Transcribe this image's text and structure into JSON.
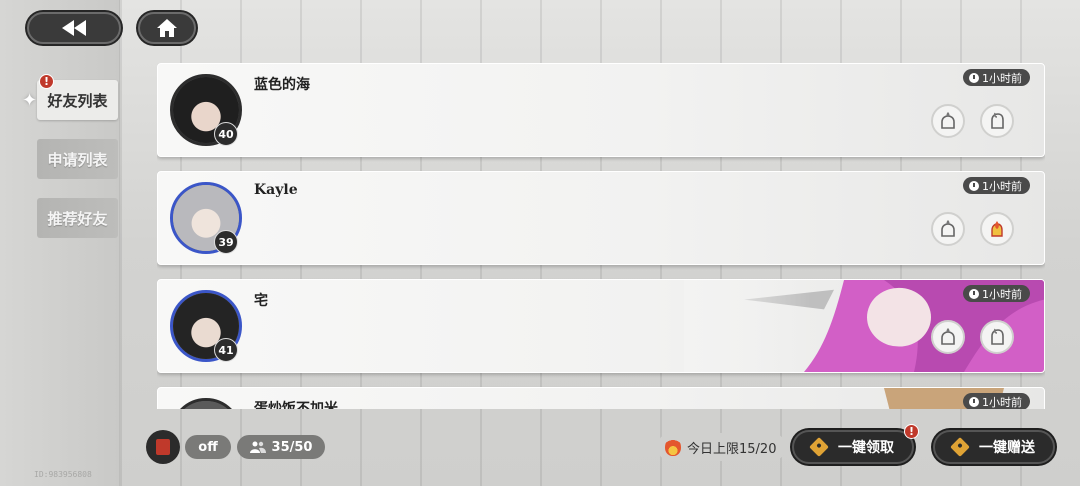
{
  "nav": {
    "tabs": [
      {
        "label": "好友列表",
        "active": true,
        "alert": "!"
      },
      {
        "label": "申请列表",
        "active": false
      },
      {
        "label": "推荐好友",
        "active": false
      }
    ]
  },
  "friends": [
    {
      "name": "蓝色的海",
      "level": "40",
      "time": "1小时前",
      "gift_received": false
    },
    {
      "name": "Kayle",
      "level": "39",
      "time": "1小时前",
      "gift_received": true
    },
    {
      "name": "宅",
      "level": "41",
      "time": "1小时前",
      "gift_received": false
    },
    {
      "name": "蛋炒饭不加米",
      "level": "",
      "time": "1小时前",
      "gift_received": false
    }
  ],
  "bottom": {
    "toggle_label": "off",
    "friend_count": "35/50",
    "daily_limit": "今日上限15/20",
    "claim_all": "一键领取",
    "claim_alert": "!",
    "send_all": "一键赠送"
  },
  "footer": {
    "uid": "ID:983956808"
  },
  "colors": {
    "alert": "#c0392b",
    "accent_gold": "#e0a335",
    "dark_button": "#2b2b2b"
  }
}
